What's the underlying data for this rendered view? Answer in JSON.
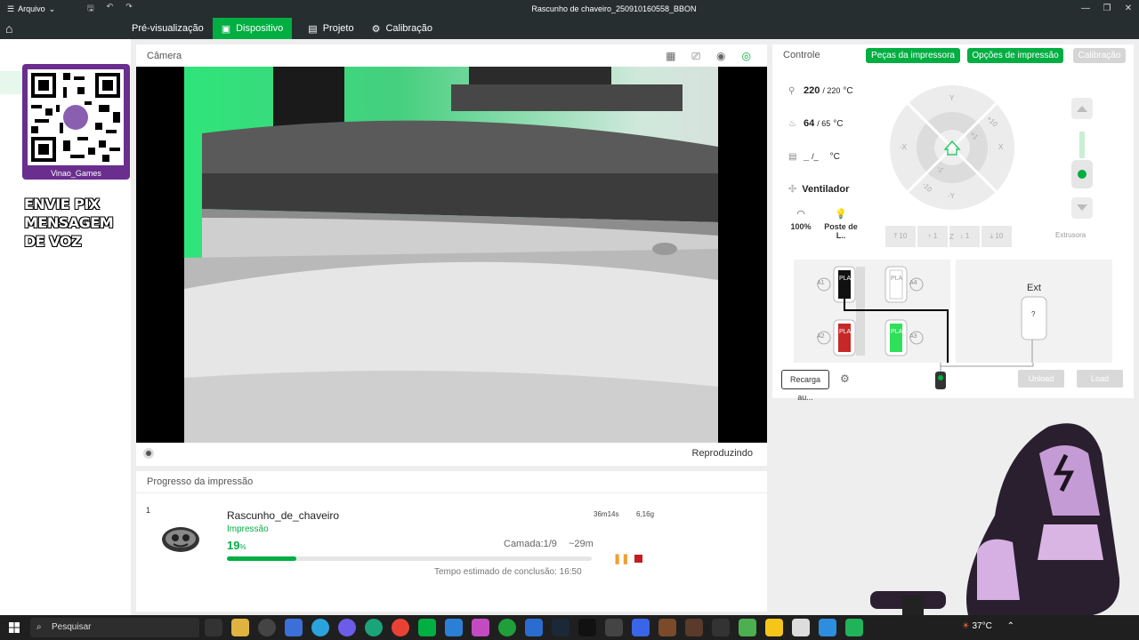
{
  "titlebar": {
    "menu_label": "Arquivo",
    "window_title": "Rascunho de chaveiro_250910160558_BBON"
  },
  "tabs": [
    {
      "label": "Pré-visualização"
    },
    {
      "label": "Dispositivo"
    },
    {
      "label": "Projeto"
    },
    {
      "label": "Calibração"
    }
  ],
  "overlay": {
    "qr_name": "Vinao_Games",
    "pix_line1": "ENVIE PIX",
    "pix_line2": "MENSAGEM DE VOZ"
  },
  "camera": {
    "title": "Câmera",
    "status": "Reproduzindo"
  },
  "progress": {
    "title": "Progresso da impressão",
    "plate": "1",
    "job_name": "Rascunho_de_chaveiro",
    "state": "Impressão",
    "duration": "36m14s",
    "weight": "6,16g",
    "percent": "19",
    "percent_unit": "%",
    "percent_value": 0.19,
    "layer": "Camada:1/9",
    "remaining": "~29m",
    "eta": "Tempo estimado de conclusão: 16:50"
  },
  "control": {
    "title": "Controle",
    "btn_parts": "Peças da impressora",
    "btn_options": "Opções de impressão",
    "btn_calib": "Calibração",
    "nozzle_temp": "220",
    "nozzle_target": "/ 220",
    "bed_temp": "64",
    "bed_target": "/ 65",
    "chamber_temp": "_",
    "chamber_target": "/_",
    "temp_unit": "°C",
    "fan_label": "Ventilador",
    "speed": "100%",
    "post_label": "Poste de L..",
    "jog_labels": {
      "y_pos": "Y",
      "y_neg": "-Y",
      "x_pos": "X",
      "x_neg": "-X",
      "p10": "+10",
      "p1": "+1",
      "m1": "-1",
      "m10": "-10"
    },
    "z_buttons": [
      "10",
      "1",
      "1",
      "10"
    ],
    "z_label": "Z",
    "extruder_label": "Extrusora",
    "ams_slots": [
      {
        "id": "A1",
        "material": "PLA",
        "color": "#111111"
      },
      {
        "id": "A4",
        "material": "PLA",
        "color": "#ffffff"
      },
      {
        "id": "A2",
        "material": "PLA",
        "color": "#c62828"
      },
      {
        "id": "A3",
        "material": "PLA",
        "color": "#2ee05a"
      }
    ],
    "ext_title": "Ext",
    "ext_slot": "?",
    "recarga": "Recarga au...",
    "unload": "Unload",
    "load": "Load"
  },
  "taskbar": {
    "search_placeholder": "Pesquisar",
    "weather": "37°C"
  }
}
